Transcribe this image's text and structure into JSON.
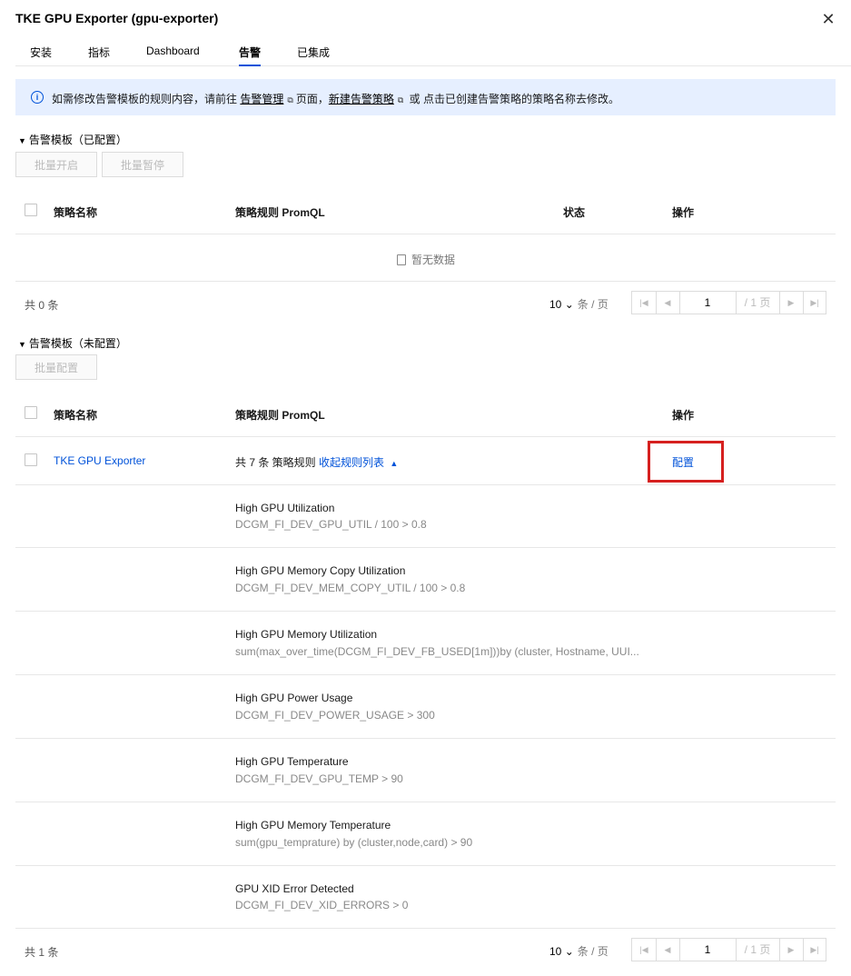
{
  "dialog": {
    "title": "TKE GPU Exporter (gpu-exporter)",
    "close_icon": "close-icon"
  },
  "tabs": [
    {
      "label": "安装"
    },
    {
      "label": "指标"
    },
    {
      "label": "Dashboard"
    },
    {
      "label": "告警",
      "active": true
    },
    {
      "label": "已集成"
    }
  ],
  "notice": {
    "prefix": "如需修改告警模板的规则内容，请前往",
    "link1": "告警管理",
    "middle": "页面，",
    "link2": "新建告警策略",
    "suffix": "或 点击已创建告警策略的策略名称去修改。"
  },
  "configured": {
    "title": "告警模板（已配置）",
    "btn_enable": "批量开启",
    "btn_pause": "批量暂停",
    "columns": [
      "策略名称",
      "策略规则 PromQL",
      "状态",
      "操作"
    ],
    "empty_text": "暂无数据",
    "total": "共 0 条",
    "page_size": "10",
    "page_size_unit": "条 / 页",
    "page": "1",
    "page_total": "/ 1 页"
  },
  "unconfigured": {
    "title": "告警模板（未配置）",
    "btn_config": "批量配置",
    "columns": [
      "策略名称",
      "策略规则 PromQL",
      "操作"
    ],
    "row": {
      "name": "TKE GPU Exporter",
      "rule_count": "共 7 条 策略规则",
      "collapse": "收起规则列表",
      "action": "配置"
    },
    "rules": [
      {
        "name": "High GPU Utilization",
        "expr": "DCGM_FI_DEV_GPU_UTIL / 100 > 0.8"
      },
      {
        "name": "High GPU Memory Copy Utilization",
        "expr": "DCGM_FI_DEV_MEM_COPY_UTIL / 100 > 0.8"
      },
      {
        "name": "High GPU Memory Utilization",
        "expr": "sum(max_over_time(DCGM_FI_DEV_FB_USED[1m]))by (cluster, Hostname, UUI..."
      },
      {
        "name": "High GPU Power Usage",
        "expr": "DCGM_FI_DEV_POWER_USAGE > 300"
      },
      {
        "name": "High GPU Temperature",
        "expr": "DCGM_FI_DEV_GPU_TEMP > 90"
      },
      {
        "name": "High GPU Memory Temperature",
        "expr": "sum(gpu_temprature) by (cluster,node,card) > 90"
      },
      {
        "name": "GPU XID Error Detected",
        "expr": "DCGM_FI_DEV_XID_ERRORS > 0"
      }
    ],
    "total": "共 1 条",
    "page_size": "10",
    "page_size_unit": "条 / 页",
    "page": "1",
    "page_total": "/ 1 页"
  },
  "colors": {
    "accent": "#0052d9",
    "highlight": "#d6201f",
    "notice_bg": "#e6efff"
  }
}
